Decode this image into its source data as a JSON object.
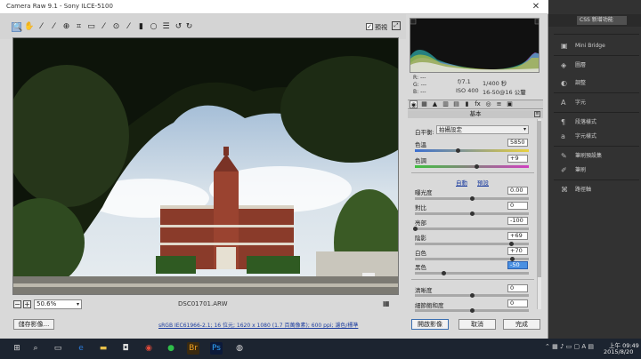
{
  "window": {
    "title": "Camera Raw 9.1  -  Sony ILCE-5100"
  },
  "toolbar": {
    "preview_label": "預視",
    "preview_checked": "✓"
  },
  "zoom": {
    "value": "50.6%"
  },
  "image": {
    "filename": "DSC01701.ARW"
  },
  "histogram_info": {
    "r_label": "R:",
    "g_label": "G:",
    "b_label": "B:",
    "r_value": "---",
    "g_value": "---",
    "b_value": "---",
    "aperture": "f/7.1",
    "shutter": "1/400 秒",
    "iso": "ISO 400",
    "lens": "16-50@16 公釐"
  },
  "panel": {
    "title": "基本",
    "white_balance_label": "白平衡:",
    "white_balance_value": "拍攝設定",
    "sliders": [
      {
        "label": "色溫",
        "value": "5850"
      },
      {
        "label": "色調",
        "value": "+9"
      },
      {
        "label": "曝光度",
        "value": "0.00"
      },
      {
        "label": "對比",
        "value": "0"
      },
      {
        "label": "亮部",
        "value": "-100"
      },
      {
        "label": "陰影",
        "value": "+69"
      },
      {
        "label": "白色",
        "value": "+70"
      },
      {
        "label": "黑色",
        "value": "-50"
      },
      {
        "label": "清晰度",
        "value": "0"
      },
      {
        "label": "細節飽和度",
        "value": "0"
      }
    ],
    "auto_link": "自動",
    "default_link": "預設"
  },
  "footer": {
    "save_button": "儲存影像...",
    "workflow_link": "sRGB IEC61966-2.1; 16 位元; 1620 x 1080 (1.7 百萬像素); 600 ppi; 濾色/標準",
    "open_button": "開啟影像",
    "cancel_button": "取消",
    "done_button": "完成"
  },
  "ps_panel": {
    "workspace": "CSS 新增功能",
    "items": [
      "Mini Bridge",
      "圖層",
      "調整",
      "字元",
      "段落樣式",
      "字元樣式",
      "筆刷預設集",
      "筆刷",
      "路徑軸"
    ]
  },
  "taskbar": {
    "time": "上午 09:49",
    "date": "2015/8/20",
    "ime_indicator": "A"
  },
  "colors": {
    "selected_value": "#4a90e2",
    "link": "#1f3fa0",
    "taskbar": "#1c2430"
  }
}
